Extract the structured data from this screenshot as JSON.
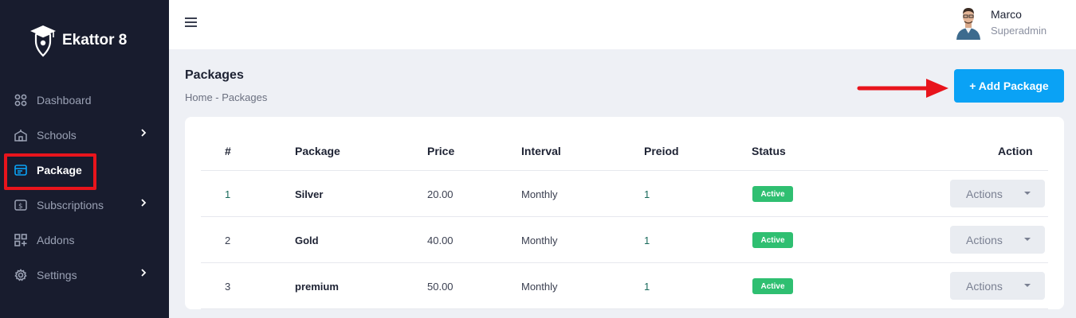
{
  "sidebar": {
    "brand": "Ekattor 8",
    "items": [
      {
        "label": "Dashboard",
        "icon": "grid-icon"
      },
      {
        "label": "Schools",
        "icon": "school-icon",
        "has_children": true
      },
      {
        "label": "Package",
        "icon": "package-icon",
        "active": true
      },
      {
        "label": "Subscriptions",
        "icon": "subscription-icon",
        "has_children": true
      },
      {
        "label": "Addons",
        "icon": "addons-icon"
      },
      {
        "label": "Settings",
        "icon": "gear-icon",
        "has_children": true
      }
    ]
  },
  "header": {
    "user_name": "Marco",
    "user_role": "Superadmin"
  },
  "page": {
    "title": "Packages",
    "breadcrumb": "Home - Packages",
    "add_button": "+ Add Package"
  },
  "table": {
    "columns": [
      "#",
      "Package",
      "Price",
      "Interval",
      "Preiod",
      "Status",
      "Action"
    ],
    "rows": [
      {
        "num": "1",
        "package": "Silver",
        "price": "20.00",
        "interval": "Monthly",
        "period": "1",
        "status": "Active",
        "action": "Actions"
      },
      {
        "num": "2",
        "package": "Gold",
        "price": "40.00",
        "interval": "Monthly",
        "period": "1",
        "status": "Active",
        "action": "Actions"
      },
      {
        "num": "3",
        "package": "premium",
        "price": "50.00",
        "interval": "Monthly",
        "period": "1",
        "status": "Active",
        "action": "Actions"
      }
    ]
  },
  "colors": {
    "sidebar_bg": "#181c2e",
    "accent": "#0aa2f5",
    "status_active": "#2fbf71",
    "annotation_red": "#e8141c"
  }
}
